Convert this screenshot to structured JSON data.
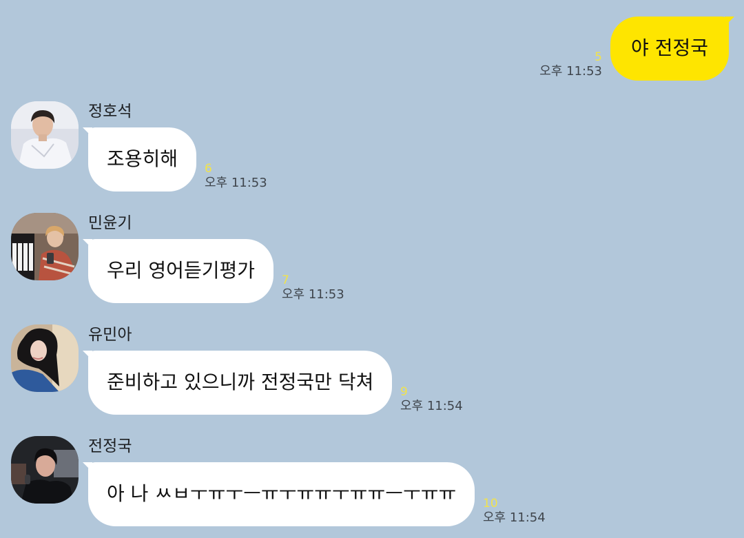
{
  "colors": {
    "background": "#b2c7da",
    "outgoing_bubble": "#fee500",
    "incoming_bubble": "#ffffff",
    "unread_count": "#f2e34b",
    "time_text": "#3f454c"
  },
  "outgoing": {
    "text": "야 전정국",
    "unread": "5",
    "time": "오후 11:53"
  },
  "messages": [
    {
      "sender": "정호석",
      "avatar_icon": "profile-photo-man-white-shirt",
      "text": "조용히해",
      "unread": "6",
      "time": "오후 11:53"
    },
    {
      "sender": "민윤기",
      "avatar_icon": "profile-photo-man-piano",
      "text": "우리 영어듣기평가",
      "unread": "7",
      "time": "오후 11:53"
    },
    {
      "sender": "유민아",
      "avatar_icon": "profile-photo-woman-long-hair",
      "text": "준비하고 있으니까 전정국만 닥쳐",
      "unread": "9",
      "time": "오후 11:54"
    },
    {
      "sender": "전정국",
      "avatar_icon": "profile-photo-man-dark",
      "text": "아 나 ㅆㅂㅜㅠㅜㅡㅠㅜㅠㅠㅜㅠㅠㅡㅜㅠㅠ",
      "unread": "10",
      "time": "오후 11:54"
    }
  ]
}
